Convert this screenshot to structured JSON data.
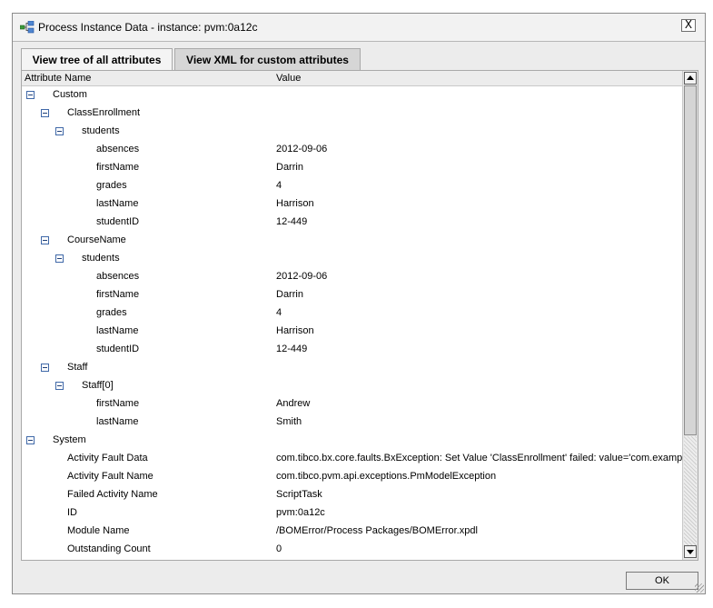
{
  "dialog": {
    "title": "Process Instance Data - instance: pvm:0a12c",
    "close_label": "X",
    "ok_label": "OK"
  },
  "tabs": [
    {
      "label": "View tree of all attributes",
      "active": true
    },
    {
      "label": "View XML for custom attributes",
      "active": false
    }
  ],
  "columns": {
    "name": "Attribute Name",
    "value": "Value"
  },
  "rows": [
    {
      "name": "Custom",
      "value": "",
      "level": 0,
      "expandable": true
    },
    {
      "name": "ClassEnrollment",
      "value": "",
      "level": 1,
      "expandable": true
    },
    {
      "name": "students",
      "value": "",
      "level": 2,
      "expandable": true
    },
    {
      "name": "absences",
      "value": "2012-09-06",
      "level": 3,
      "expandable": false
    },
    {
      "name": "firstName",
      "value": "Darrin",
      "level": 3,
      "expandable": false
    },
    {
      "name": "grades",
      "value": "4",
      "level": 3,
      "expandable": false
    },
    {
      "name": "lastName",
      "value": "Harrison",
      "level": 3,
      "expandable": false
    },
    {
      "name": "studentID",
      "value": "12-449",
      "level": 3,
      "expandable": false
    },
    {
      "name": "CourseName",
      "value": "",
      "level": 1,
      "expandable": true
    },
    {
      "name": "students",
      "value": "",
      "level": 2,
      "expandable": true
    },
    {
      "name": "absences",
      "value": "2012-09-06",
      "level": 3,
      "expandable": false
    },
    {
      "name": "firstName",
      "value": "Darrin",
      "level": 3,
      "expandable": false
    },
    {
      "name": "grades",
      "value": "4",
      "level": 3,
      "expandable": false
    },
    {
      "name": "lastName",
      "value": "Harrison",
      "level": 3,
      "expandable": false
    },
    {
      "name": "studentID",
      "value": "12-449",
      "level": 3,
      "expandable": false
    },
    {
      "name": "Staff",
      "value": "",
      "level": 1,
      "expandable": true
    },
    {
      "name": "Staff[0]",
      "value": "",
      "level": 2,
      "expandable": true
    },
    {
      "name": "firstName",
      "value": "Andrew",
      "level": 3,
      "expandable": false
    },
    {
      "name": "lastName",
      "value": "Smith",
      "level": 3,
      "expandable": false
    },
    {
      "name": "System",
      "value": "",
      "level": 0,
      "expandable": true
    },
    {
      "name": "Activity Fault Data",
      "value": "com.tibco.bx.core.faults.BxException: Set Value 'ClassEnrollment' failed: value='com.example.",
      "level": 1,
      "expandable": false
    },
    {
      "name": "Activity Fault Name",
      "value": "com.tibco.pvm.api.exceptions.PmModelException",
      "level": 1,
      "expandable": false
    },
    {
      "name": "Failed Activity Name",
      "value": "ScriptTask",
      "level": 1,
      "expandable": false
    },
    {
      "name": "ID",
      "value": "pvm:0a12c",
      "level": 1,
      "expandable": false
    },
    {
      "name": "Module Name",
      "value": "/BOMError/Process Packages/BOMError.xpdl",
      "level": 1,
      "expandable": false
    },
    {
      "name": "Outstanding Count",
      "value": "0",
      "level": 1,
      "expandable": false
    }
  ],
  "colors": {
    "toggle_border": "#3f68a8",
    "title_icon": "#2d7a2d"
  }
}
